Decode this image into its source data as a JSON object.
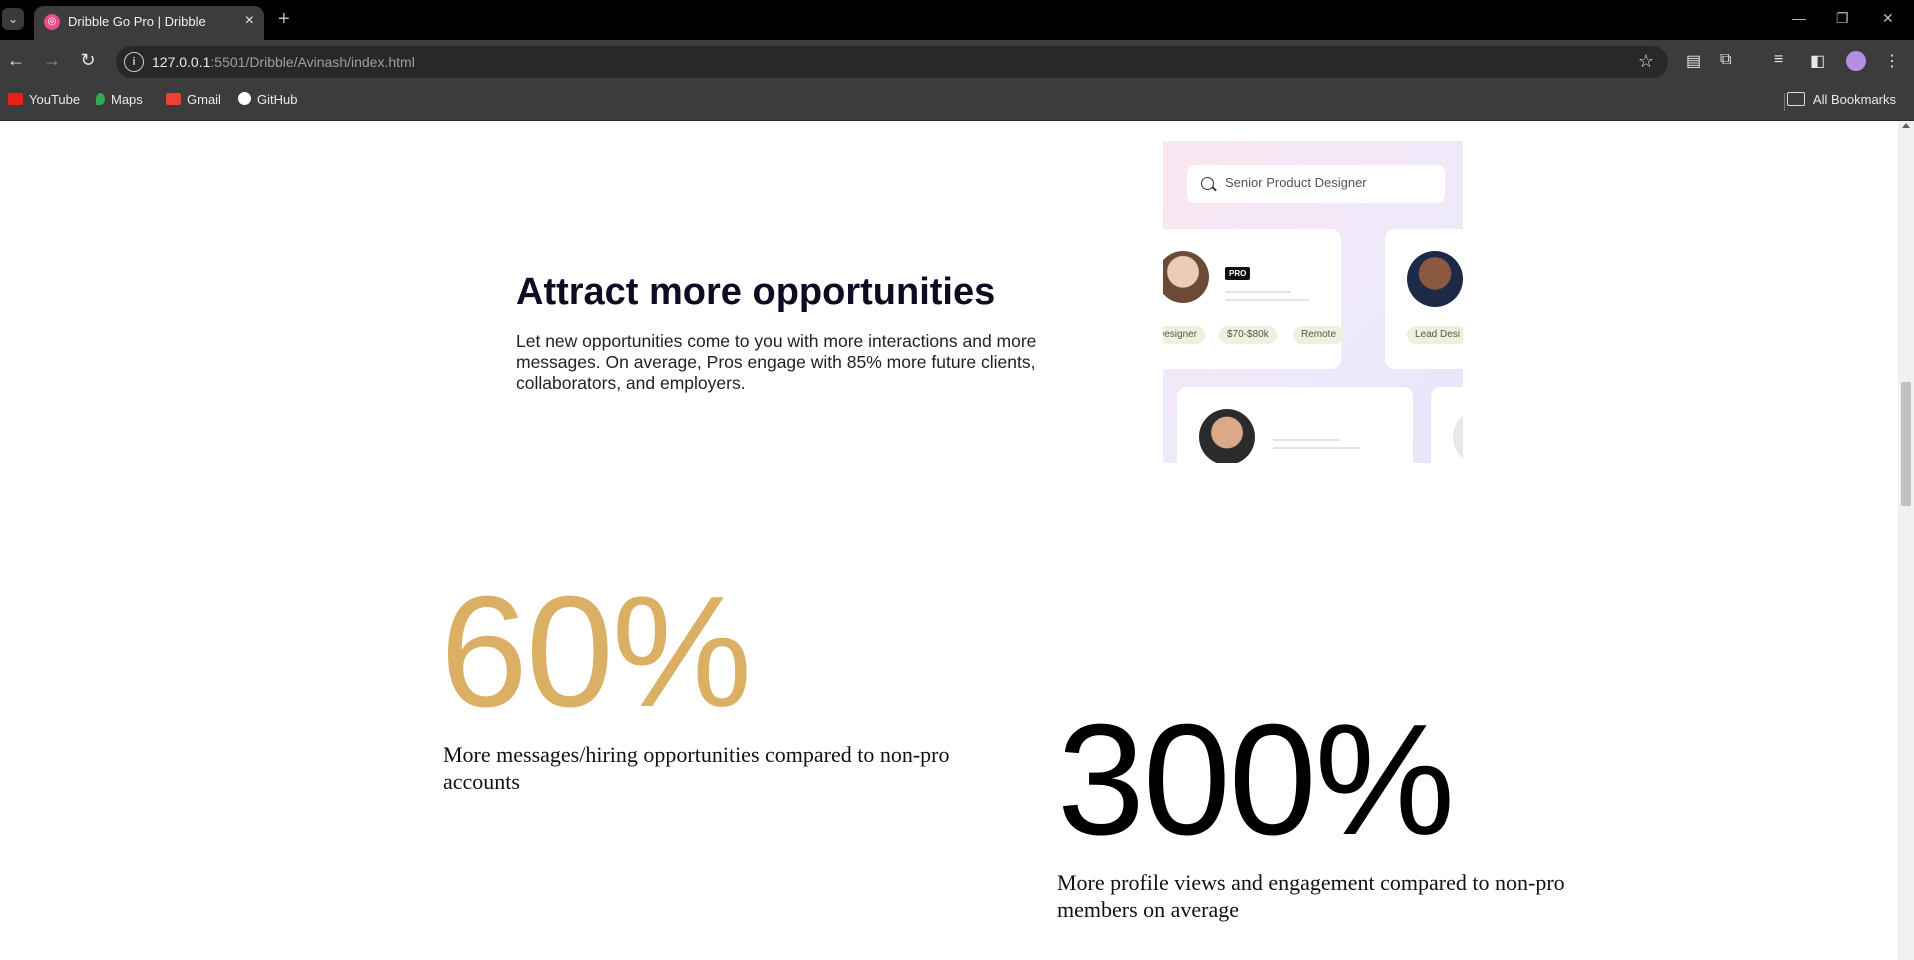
{
  "browser": {
    "tab_title": "Dribble Go Pro | Dribble",
    "url_host": "127.0.0.1",
    "url_path": ":5501/Dribble/Avinash/index.html",
    "bookmarks": [
      "YouTube",
      "Maps",
      "Gmail",
      "GitHub"
    ],
    "all_bookmarks": "All Bookmarks"
  },
  "feature": {
    "title": "Attract more opportunities",
    "text": "Let new opportunities come to you with more interactions and more messages. On average, Pros engage with 85% more future clients, collaborators, and employers."
  },
  "mockup": {
    "search_placeholder": "Senior Product Designer",
    "pro_badge": "PRO",
    "chips": [
      "Designer",
      "$70-$80k",
      "Remote",
      "Lead Desi"
    ]
  },
  "stats": [
    {
      "value": "60%",
      "label": "More messages/hiring opportunities compared to non-pro accounts",
      "color": "#dbb065"
    },
    {
      "value": "300%",
      "label": "More profile views and engagement compared to non-pro members on average",
      "color": "#000000"
    }
  ]
}
